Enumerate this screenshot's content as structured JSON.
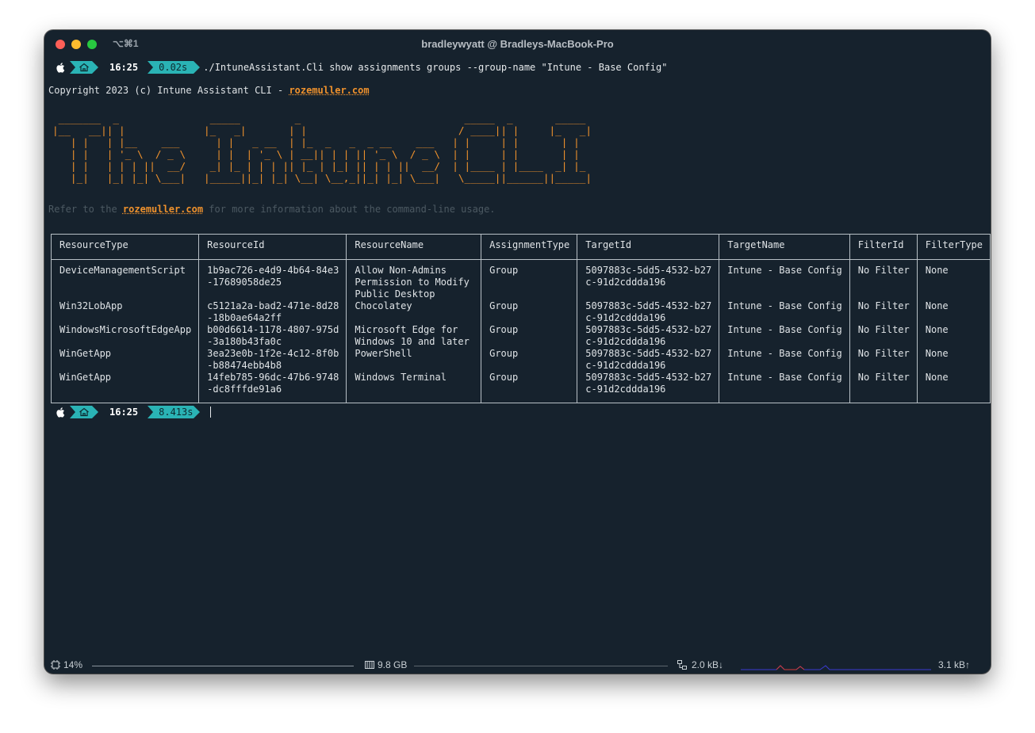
{
  "window": {
    "title": "bradleywyatt @ Bradleys-MacBook-Pro",
    "shortcut": "⌥⌘1"
  },
  "prompt1": {
    "time": "16:25",
    "duration": "0.02s",
    "command": "./IntuneAssistant.Cli show assignments groups --group-name \"Intune - Base Config\""
  },
  "copyright": {
    "prefix": "Copyright 2023 (c) Intune Assistant CLI - ",
    "link": "rozemuller.com"
  },
  "banner_lines": [
    " _______  _               _____         _                           _____  _       _____ ",
    "|__   __|| |             |_   _|       | |                         / ____|| |     |_   _|",
    "   | |   | |__    ___      | |   _ __  | |_  _   _  _ __    ___   | |     | |       | |  ",
    "   | |   | '_ \\  / _ \\     | |  | '_ \\ | __|| | | || '_ \\  / _ \\  | |     | |       | |  ",
    "   | |   | | | ||  __/    _| |_ | | | || |_ | |_| || | | ||  __/  | |____ | |____  _| |_ ",
    "   |_|   |_| |_| \\___|   |_____||_| |_| \\__| \\__,_||_| |_| \\___|   \\_____||______||_____|"
  ],
  "refer": {
    "prefix": "Refer to the ",
    "link": "rozemuller.com",
    "suffix": " for more information about the command-line usage."
  },
  "table": {
    "headers": [
      "ResourceType",
      "ResourceId",
      "ResourceName",
      "AssignmentType",
      "TargetId",
      "TargetName",
      "FilterId",
      "FilterType"
    ],
    "rows": [
      [
        "DeviceManagementScript",
        "1b9ac726-e4d9-4b64-84e3\n-17689058de25",
        "Allow Non-Admins\nPermission to Modify\nPublic Desktop",
        "Group",
        "5097883c-5dd5-4532-b27\nc-91d2cddda196",
        "Intune - Base Config",
        "No Filter",
        "None"
      ],
      [
        "Win32LobApp",
        "c5121a2a-bad2-471e-8d28\n-18b0ae64a2ff",
        "Chocolatey",
        "Group",
        "5097883c-5dd5-4532-b27\nc-91d2cddda196",
        "Intune - Base Config",
        "No Filter",
        "None"
      ],
      [
        "WindowsMicrosoftEdgeApp",
        "b00d6614-1178-4807-975d\n-3a180b43fa0c",
        "Microsoft Edge for\nWindows 10 and later",
        "Group",
        "5097883c-5dd5-4532-b27\nc-91d2cddda196",
        "Intune - Base Config",
        "No Filter",
        "None"
      ],
      [
        "WinGetApp",
        "3ea23e0b-1f2e-4c12-8f0b\n-b88474ebb4b8",
        "PowerShell",
        "Group",
        "5097883c-5dd5-4532-b27\nc-91d2cddda196",
        "Intune - Base Config",
        "No Filter",
        "None"
      ],
      [
        "WinGetApp",
        "14feb785-96dc-47b6-9748\n-dc8fffde91a6",
        "Windows Terminal",
        "Group",
        "5097883c-5dd5-4532-b27\nc-91d2cddda196",
        "Intune - Base Config",
        "No Filter",
        "None"
      ]
    ]
  },
  "prompt2": {
    "time": "16:25",
    "duration": "8.413s"
  },
  "statusbar": {
    "cpu": "14%",
    "memory": "9.8 GB",
    "net_down": "2.0 kB↓",
    "net_up": "3.1 kB↑"
  },
  "colors": {
    "background": "#16222d",
    "accent_teal": "#2ab3b5",
    "banner_orange": "#f0922d",
    "link_orange": "#f0922d"
  },
  "icons": [
    "apple-icon",
    "home-icon",
    "cpu-icon",
    "memory-icon",
    "network-icon"
  ]
}
